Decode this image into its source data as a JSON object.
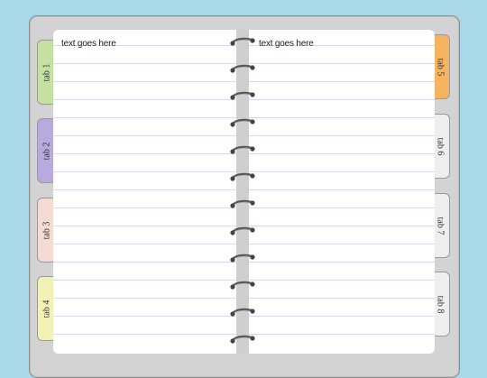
{
  "tabs_left": [
    {
      "label": "tab 1",
      "color": "#c6e0a4"
    },
    {
      "label": "tab 2",
      "color": "#b8a9de"
    },
    {
      "label": "tab 3",
      "color": "#f4dcd2"
    },
    {
      "label": "tab 4",
      "color": "#f3f2b6"
    }
  ],
  "tabs_right": [
    {
      "label": "tab 5",
      "color": "#f6b461"
    },
    {
      "label": "tab 6",
      "color": "#eeeeee"
    },
    {
      "label": "tab 7",
      "color": "#eeeeee"
    },
    {
      "label": "tab 8",
      "color": "#eeeeee"
    }
  ],
  "left_page": {
    "text": "text goes here"
  },
  "right_page": {
    "text": "text goes here"
  },
  "colors": {
    "background": "#a9d8e8",
    "binder": "#d3d3d3",
    "rule_line": "#d6d9f2"
  }
}
